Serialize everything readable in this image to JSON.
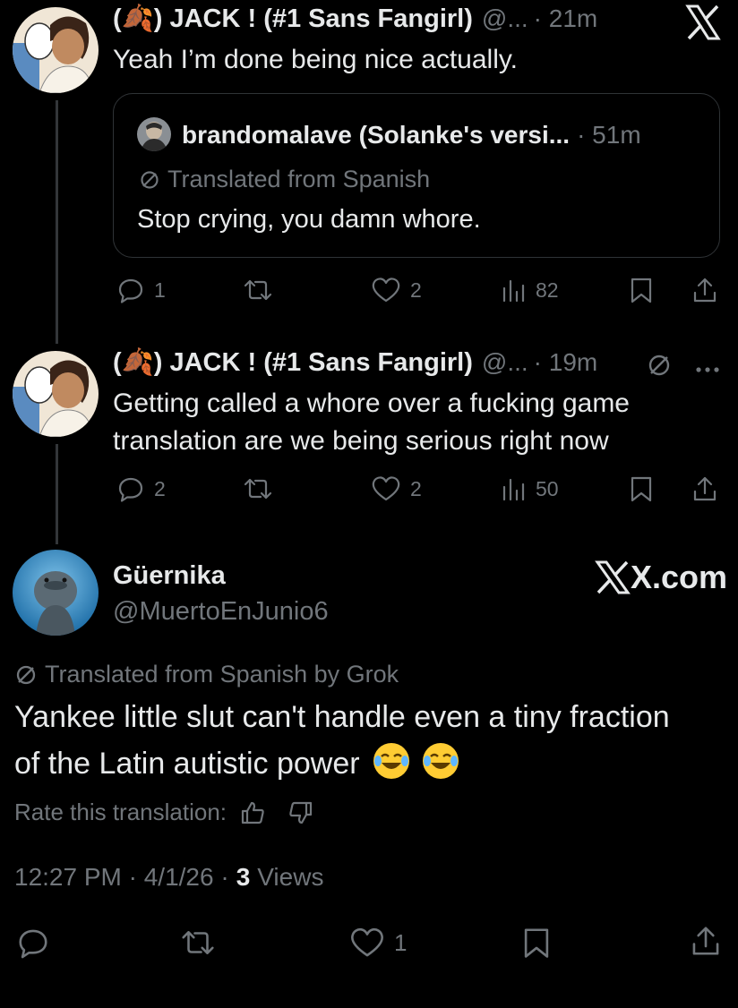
{
  "tweet1": {
    "name": "(🍂) JACK ! (#1 Sans Fangirl)",
    "handle": "@...",
    "time": "· 21m",
    "text": "Yeah I’m done being nice actually.",
    "quote": {
      "name": "brandomalave (Solanke's versi...",
      "time": "· 51m",
      "translated_label": "Translated from Spanish",
      "text": "Stop crying, you damn whore."
    },
    "actions": {
      "replies": "1",
      "likes": "2",
      "views": "82"
    }
  },
  "tweet2": {
    "name": "(🍂) JACK ! (#1 Sans Fangirl)",
    "handle": "@...",
    "time": "· 19m",
    "text_line1": "Getting called a whore over a fucking game",
    "text_line2": "translation are we being serious right now",
    "actions": {
      "replies": "2",
      "likes": "2",
      "views": "50"
    }
  },
  "main": {
    "name": "Güernika",
    "handle": "@MuertoEnJunio6",
    "xcom": "X.com",
    "translated_label": "Translated from Spanish by Grok",
    "text_line1": "Yankee little slut can't handle even a tiny fraction",
    "text_line2": "of the Latin autistic power",
    "rate_label": "Rate this translation:",
    "timestamp": "12:27 PM · 4/1/26 ·",
    "views_count": "3",
    "views_label": "Views",
    "likes": "1"
  },
  "colors": {
    "background": "#000000",
    "text": "#e7e9ea",
    "muted": "#71767b",
    "border": "#2f3336"
  },
  "icons": [
    "x-logo-icon",
    "reply-icon",
    "retweet-icon",
    "like-icon",
    "views-icon",
    "bookmark-icon",
    "share-icon",
    "translate-icon",
    "more-icon",
    "thumbs-up-icon",
    "thumbs-down-icon",
    "laughing-emoji-icon"
  ]
}
